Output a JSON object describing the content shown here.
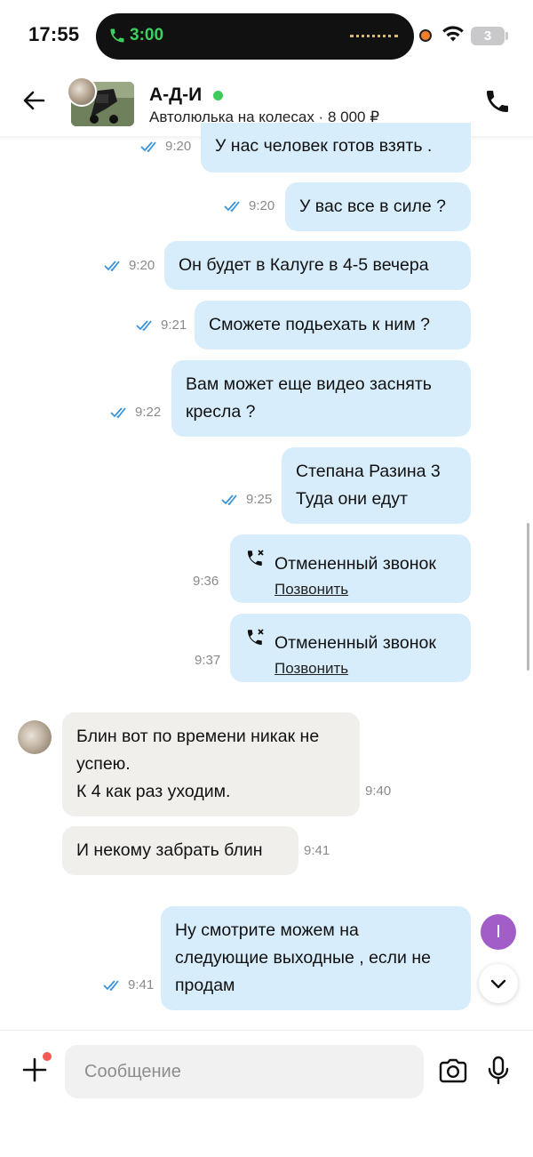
{
  "status_bar": {
    "time": "17:55",
    "call_timer": "3:00",
    "battery": "3"
  },
  "header": {
    "name": "А-Д-И",
    "subtitle": "Автолюлька на колесах · 8 000 ₽",
    "online_color": "#3fcb5c"
  },
  "messages": [
    {
      "text": "У нас человек готов взять .",
      "time": "9:20"
    },
    {
      "text": "У вас все в силе ?",
      "time": "9:20"
    },
    {
      "text": "Он будет в Калуге в 4-5 вечера",
      "time": "9:20"
    },
    {
      "text": "Сможете подьехать к ним ?",
      "time": "9:21"
    },
    {
      "line1": "Вам может еще видео заснять",
      "line2": "кресла ?",
      "time": "9:22"
    },
    {
      "line1": "Степана Разина 3",
      "line2": "Туда они едут",
      "time": "9:25"
    },
    {
      "title": "Отмененный звонок",
      "action": "Позвонить",
      "time": "9:36"
    },
    {
      "title": "Отмененный звонок",
      "action": "Позвонить",
      "time": "9:37"
    },
    {
      "line1": "Блин вот по времени никак не",
      "line2": "успею.",
      "line3": "К 4 как раз уходим.",
      "time": "9:40"
    },
    {
      "text": "И некому забрать блин",
      "time": "9:41"
    },
    {
      "line1": "Ну смотрите можем на",
      "line2": "следующие выходные , если не",
      "line3": "продам",
      "time": "9:41"
    }
  ],
  "me_avatar_letter": "I",
  "composer": {
    "placeholder": "Сообщение"
  },
  "colors": {
    "outgoing_bubble": "#d8edfb",
    "incoming_bubble": "#f0efeb",
    "read_ticks": "#3a93d8",
    "avatar_me": "#a35dc8"
  }
}
